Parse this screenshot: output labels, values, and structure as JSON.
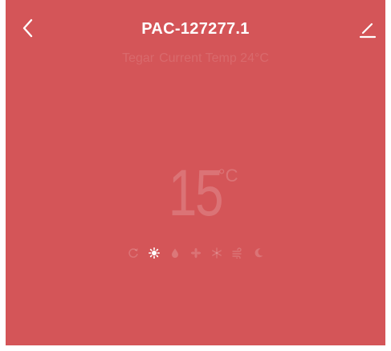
{
  "header": {
    "title": "PAC-127277.1"
  },
  "status": {
    "target_label": "Tegar",
    "current_temp_text": "Current Temp 24°C"
  },
  "thermostat": {
    "set_temp": "15",
    "unit": "°C"
  },
  "modes": [
    {
      "name": "auto-mode-icon",
      "active": false
    },
    {
      "name": "sun-mode-icon",
      "active": true
    },
    {
      "name": "drop-mode-icon",
      "active": false
    },
    {
      "name": "fan-mode-icon",
      "active": false
    },
    {
      "name": "snowflake-mode-icon",
      "active": false
    },
    {
      "name": "wind-mode-icon",
      "active": false
    },
    {
      "name": "moon-mode-icon",
      "active": false
    }
  ],
  "colors": {
    "background": "#d45558",
    "foreground": "#ffffff"
  }
}
